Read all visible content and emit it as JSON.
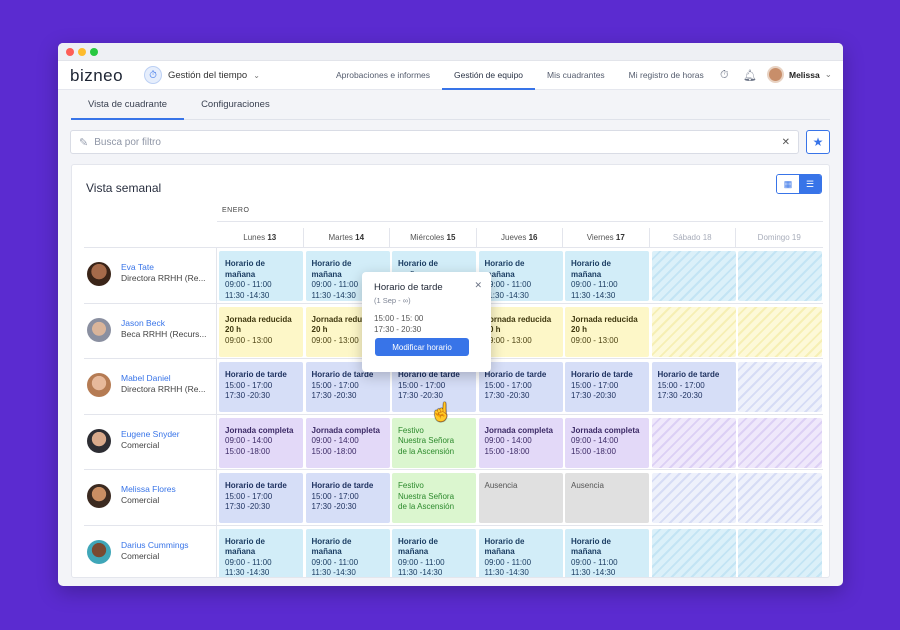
{
  "app": {
    "logo": "bizneo",
    "module_label": "Gestión del tiempo",
    "nav": [
      "Aprobaciones e informes",
      "Gestión de equipo",
      "Mis cuadrantes",
      "Mi registro de horas"
    ],
    "user_name": "Melissa"
  },
  "subtabs": [
    "Vista de cuadrante",
    "Configuraciones"
  ],
  "search": {
    "placeholder": "Busca por filtro"
  },
  "schedule": {
    "title": "Vista semanal",
    "month": "ENERO",
    "days": [
      {
        "name": "Lunes",
        "num": "13"
      },
      {
        "name": "Martes",
        "num": "14"
      },
      {
        "name": "Miércoles",
        "num": "15"
      },
      {
        "name": "Jueves",
        "num": "16"
      },
      {
        "name": "Viernes",
        "num": "17"
      },
      {
        "name": "Sábado",
        "num": "18"
      },
      {
        "name": "Domingo",
        "num": "19"
      }
    ],
    "people": [
      {
        "name": "Eva Tate",
        "role": "Directora RRHH (Re..."
      },
      {
        "name": "Jason Beck",
        "role": "Beca RRHH (Recurs..."
      },
      {
        "name": "Mabel Daniel",
        "role": "Directora RRHH (Re..."
      },
      {
        "name": "Eugene Snyder",
        "role": "Comercial"
      },
      {
        "name": "Melissa Flores",
        "role": "Comercial"
      },
      {
        "name": "Darius Cummings",
        "role": "Comercial"
      }
    ],
    "shifts": {
      "morning": {
        "title": "Horario de mañana",
        "l1": "09:00 - 11:00",
        "l2": "11:30 -14:30"
      },
      "afternoon": {
        "title": "Horario de tarde",
        "l1": "15:00 - 17:00",
        "l2": "17:30 -20:30"
      },
      "reduced": {
        "title": "Jornada reducida",
        "l1": "20 h",
        "l2": "09:00 - 13:00"
      },
      "full": {
        "title": "Jornada completa",
        "l1": "09:00 - 14:00",
        "l2": "15:00 -18:00"
      },
      "holiday": {
        "title": "Festivo",
        "l1": "Nuestra Señora",
        "l2": "de la Ascensión"
      },
      "absence": {
        "title": "Ausencia"
      }
    }
  },
  "popover": {
    "title": "Horario de tarde",
    "date": "(1 Sep - ∞)",
    "line1": "15:00 - 15: 00",
    "line2": "17:30 - 20:30",
    "button": "Modificar horario"
  },
  "colors": {
    "accent": "#3874e8",
    "background": "#5b2bd0"
  }
}
